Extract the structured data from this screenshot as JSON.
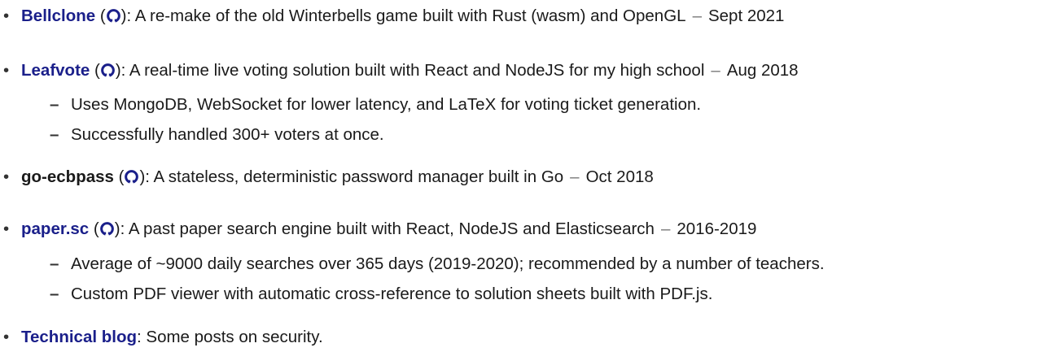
{
  "projects": [
    {
      "title": "Bellclone",
      "linked": true,
      "github": true,
      "description": ": A re-make of the old Winterbells game built with Rust (wasm) and OpenGL",
      "date": "Sept 2021",
      "details": []
    },
    {
      "title": "Leafvote",
      "linked": true,
      "github": true,
      "description": ": A real-time live voting solution built with React and NodeJS for my high school",
      "date": "Aug 2018",
      "details": [
        "Uses MongoDB, WebSocket for lower latency, and LaTeX for voting ticket generation.",
        "Successfully handled 300+ voters at once."
      ]
    },
    {
      "title": "go-ecbpass",
      "linked": false,
      "github": true,
      "description": ": A stateless, deterministic password manager built in Go",
      "date": "Oct 2018",
      "details": []
    },
    {
      "title": "paper.sc",
      "linked": true,
      "github": true,
      "description": ": A past paper search engine built with React, NodeJS and Elasticsearch",
      "date": "2016-2019",
      "details": [
        "Average of ~9000 daily searches over 365 days (2019-2020); recommended by a number of teachers.",
        "Custom PDF viewer with automatic cross-reference to solution sheets built with PDF.js."
      ]
    },
    {
      "title": "Technical blog",
      "linked": true,
      "github": false,
      "description": ": Some posts on security.",
      "date": "",
      "details": []
    }
  ],
  "symbols": {
    "bullet": "•",
    "dash": "–",
    "separator": "–",
    "open_paren": "(",
    "close_paren": ")"
  },
  "colors": {
    "link": "#1a1f8a",
    "text": "#1a1a1a",
    "separator": "#777777"
  },
  "icons": {
    "github": "github-icon"
  }
}
